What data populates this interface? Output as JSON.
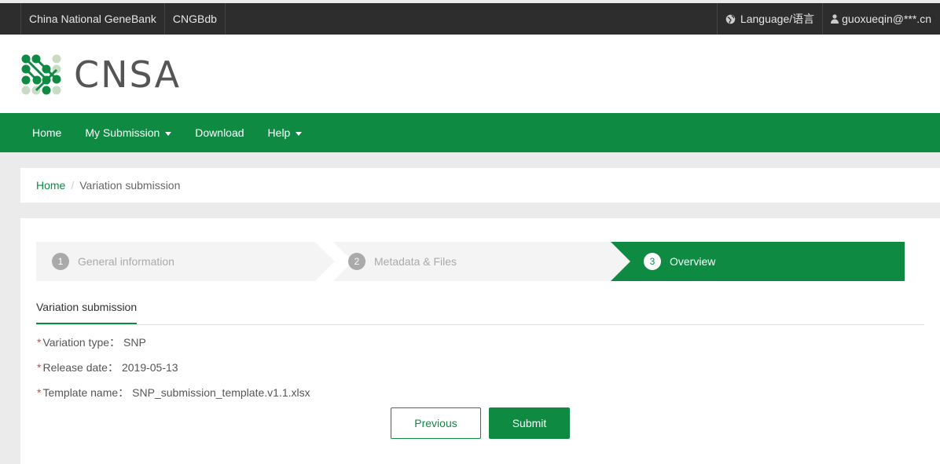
{
  "topbar": {
    "left_links": [
      "China National GeneBank",
      "CNGBdb"
    ],
    "language": "Language/语言",
    "user": "guoxueqin@***.cn",
    "icons": {
      "language": "globe-icon",
      "user": "user-icon"
    }
  },
  "brand": {
    "logo_text": "CNSA"
  },
  "nav": {
    "items": [
      {
        "label": "Home",
        "dropdown": false
      },
      {
        "label": "My Submission",
        "dropdown": true
      },
      {
        "label": "Download",
        "dropdown": false
      },
      {
        "label": "Help",
        "dropdown": true
      }
    ]
  },
  "breadcrumb": {
    "home": "Home",
    "separator": "/",
    "current": "Variation submission"
  },
  "steps": [
    {
      "num": "1",
      "label": "General information",
      "active": false
    },
    {
      "num": "2",
      "label": "Metadata & Files",
      "active": false
    },
    {
      "num": "3",
      "label": "Overview",
      "active": true
    }
  ],
  "tab": {
    "label": "Variation submission"
  },
  "fields": [
    {
      "label": "Variation type：",
      "value": "SNP"
    },
    {
      "label": "Release date：",
      "value": "2019-05-13"
    },
    {
      "label": "Template name：",
      "value": "SNP_submission_template.v1.1.xlsx"
    }
  ],
  "required_mark": "*",
  "buttons": {
    "previous": "Previous",
    "submit": "Submit"
  },
  "colors": {
    "brand_green": "#0e8a43",
    "topbar_bg": "#2d2d2d",
    "step_inactive": "#f4f4f4",
    "required": "#e2413b"
  }
}
